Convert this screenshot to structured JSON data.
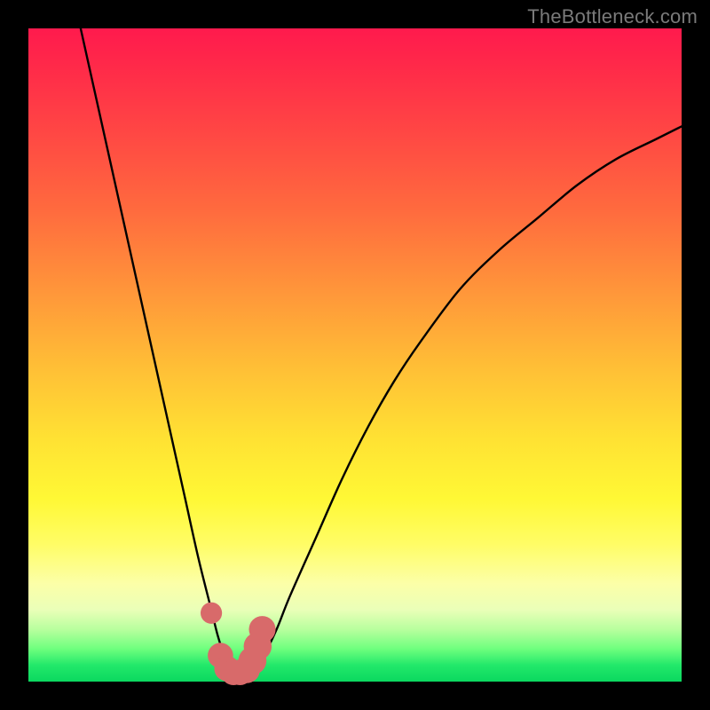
{
  "watermark": {
    "text": "TheBottleneck.com"
  },
  "chart_data": {
    "type": "line",
    "title": "",
    "xlabel": "",
    "ylabel": "",
    "xlim": [
      0,
      100
    ],
    "ylim": [
      0,
      100
    ],
    "series": [
      {
        "name": "bottleneck-curve",
        "x": [
          8,
          10,
          12,
          14,
          16,
          18,
          20,
          22,
          24,
          26,
          28,
          29,
          30,
          31,
          32,
          33,
          34,
          36,
          38,
          40,
          44,
          48,
          52,
          56,
          60,
          66,
          72,
          78,
          84,
          90,
          96,
          100
        ],
        "y": [
          100,
          91,
          82,
          73,
          64,
          55,
          46,
          37,
          28,
          19,
          11,
          7,
          4,
          2,
          1,
          1,
          2,
          4,
          8,
          13,
          22,
          31,
          39,
          46,
          52,
          60,
          66,
          71,
          76,
          80,
          83,
          85
        ]
      }
    ],
    "markers": {
      "name": "highlight-dots",
      "color": "#d86a6a",
      "points": [
        {
          "x": 28.0,
          "y": 10.5,
          "r": 1.1
        },
        {
          "x": 29.4,
          "y": 4.0,
          "r": 1.4
        },
        {
          "x": 30.4,
          "y": 2.0,
          "r": 1.4
        },
        {
          "x": 31.4,
          "y": 1.4,
          "r": 1.4
        },
        {
          "x": 32.4,
          "y": 1.4,
          "r": 1.4
        },
        {
          "x": 33.4,
          "y": 1.8,
          "r": 1.5
        },
        {
          "x": 34.3,
          "y": 3.2,
          "r": 1.6
        },
        {
          "x": 35.1,
          "y": 5.4,
          "r": 1.6
        },
        {
          "x": 35.8,
          "y": 8.0,
          "r": 1.5
        }
      ]
    },
    "background": {
      "type": "vertical-gradient",
      "stops": [
        {
          "pos": 0.0,
          "color": "#ff1a4d"
        },
        {
          "pos": 0.4,
          "color": "#ff953a"
        },
        {
          "pos": 0.72,
          "color": "#fff835"
        },
        {
          "pos": 0.92,
          "color": "#b8ff9e"
        },
        {
          "pos": 1.0,
          "color": "#0bd85f"
        }
      ]
    }
  }
}
